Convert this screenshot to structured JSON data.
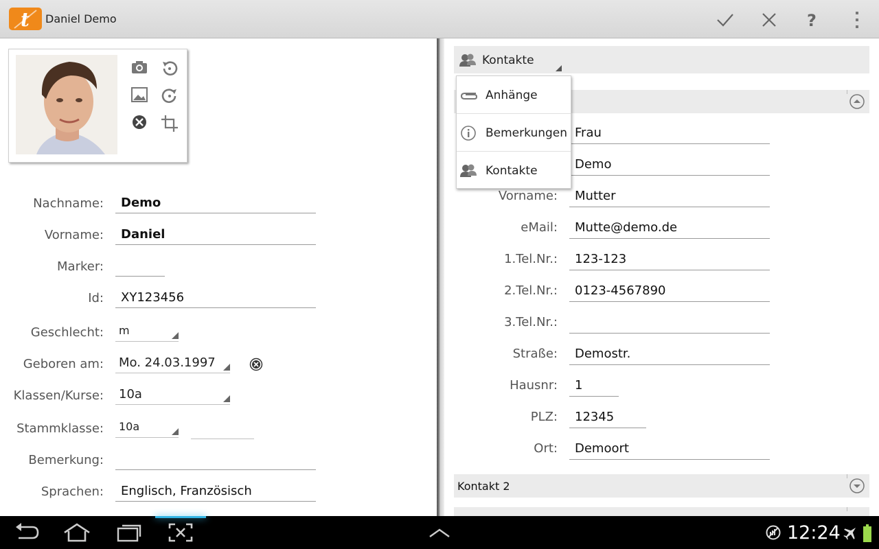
{
  "app": {
    "title": "Daniel Demo"
  },
  "actions": {
    "save": "checkmark-icon",
    "cancel": "close-icon",
    "help": "help-icon",
    "overflow": "overflow-menu-icon"
  },
  "student": {
    "fields": [
      {
        "label": "Nachname:",
        "value": "Demo"
      },
      {
        "label": "Vorname:",
        "value": "Daniel"
      },
      {
        "label": "Marker:",
        "value": ""
      },
      {
        "label": "Id:",
        "value": "XY123456"
      },
      {
        "label": "Geschlecht:",
        "value": "m"
      },
      {
        "label": "Geboren am:",
        "value": "Mo. 24.03.1997"
      },
      {
        "label": "Klassen/Kurse:",
        "value": "10a"
      },
      {
        "label": "Stammklasse:",
        "value": "10a",
        "value2": ""
      },
      {
        "label": "Bemerkung:",
        "value": ""
      },
      {
        "label": "Sprachen:",
        "value": "Englisch, Französisch"
      }
    ]
  },
  "right": {
    "selected_tab": "Kontakte",
    "menu": [
      {
        "label": "Anhänge",
        "icon": "paperclip-icon"
      },
      {
        "label": "Bemerkungen",
        "icon": "info-icon"
      },
      {
        "label": "Kontakte",
        "icon": "contacts-icon"
      }
    ],
    "contact1": {
      "fields": [
        {
          "label": "",
          "value": "Frau"
        },
        {
          "label": "",
          "value": "Demo"
        },
        {
          "label": "Vorname:",
          "value": "Mutter"
        },
        {
          "label": "eMail:",
          "value": "Mutte@demo.de"
        },
        {
          "label": "1.Tel.Nr.:",
          "value": "123-123"
        },
        {
          "label": "2.Tel.Nr.:",
          "value": "0123-4567890"
        },
        {
          "label": "3.Tel.Nr.:",
          "value": ""
        },
        {
          "label": "Straße:",
          "value": "Demostr."
        },
        {
          "label": "Hausnr:",
          "value": "1"
        },
        {
          "label": "PLZ:",
          "value": "12345"
        },
        {
          "label": "Ort:",
          "value": "Demoort"
        }
      ]
    },
    "contact2": {
      "title": "Kontakt 2"
    }
  },
  "status": {
    "time": "12:24"
  },
  "colors": {
    "accent": "#33b5e5",
    "logo": "#f0891a",
    "battery": "#9bd94c"
  }
}
